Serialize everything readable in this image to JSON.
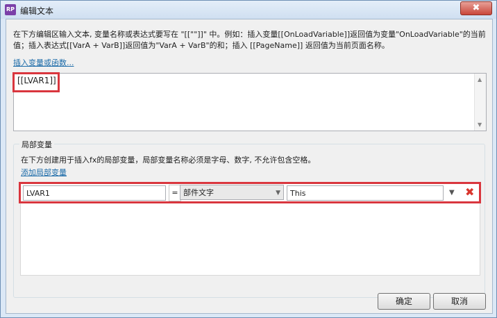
{
  "window": {
    "title": "编辑文本",
    "app_icon_text": "RP",
    "close_label": "✖"
  },
  "instructions": "在下方编辑区输入文本, 变量名称或表达式要写在 \"[[\"\"]]\" 中。例如：插入变量[[OnLoadVariable]]返回值为变量\"OnLoadVariable\"的当前值；插入表达式[[VarA + VarB]]返回值为\"VarA + VarB\"的和；插入 [[PageName]] 返回值为当前页面名称。",
  "insert_link": "插入变量或函数...",
  "editor": {
    "text": "[[LVAR1]]"
  },
  "local_vars": {
    "title": "局部变量",
    "description": "在下方创建用于插入fx的局部变量，局部变量名称必须是字母、数字, 不允许包含空格。",
    "add_link": "添加局部变量",
    "row": {
      "name": "LVAR1",
      "equals": "=",
      "type": "部件文字",
      "target": "This"
    }
  },
  "buttons": {
    "ok": "确定",
    "cancel": "取消"
  },
  "icons": {
    "dropdown": "chevron-down-icon",
    "delete": "close-x-icon",
    "scroll": "scroll-arrow-icon"
  },
  "colors": {
    "highlight": "#d9363e",
    "link": "#1a6aa8",
    "delete": "#d9362d"
  }
}
